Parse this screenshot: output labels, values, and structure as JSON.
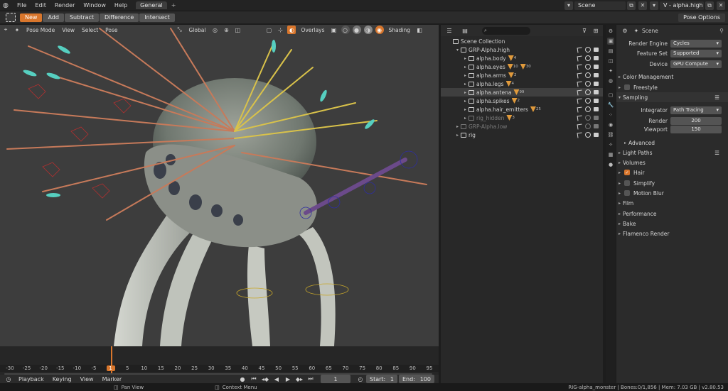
{
  "topbar": {
    "menus": [
      "File",
      "Edit",
      "Render",
      "Window",
      "Help"
    ],
    "workspace_tab": "General",
    "add_tab": "+",
    "scene_name": "Scene",
    "view_layer": "V - alpha.high"
  },
  "toolbar": {
    "modes": [
      "New",
      "Add",
      "Subtract",
      "Difference",
      "Intersect"
    ],
    "active_mode": "New",
    "pose_options": "Pose Options"
  },
  "viewport_header": {
    "mode": "Pose Mode",
    "menus": [
      "View",
      "Select",
      "Pose"
    ],
    "orientation": "Global",
    "overlays": "Overlays",
    "shading": "Shading"
  },
  "timeline": {
    "ticks": [
      "-30",
      "-25",
      "-20",
      "-15",
      "-10",
      "-5",
      "1",
      "5",
      "10",
      "15",
      "20",
      "25",
      "30",
      "35",
      "40",
      "45",
      "50",
      "55",
      "60",
      "65",
      "70",
      "75",
      "80",
      "85",
      "90",
      "95"
    ],
    "current_frame": "1",
    "start_label": "Start:",
    "start": "1",
    "end_label": "End:",
    "end": "100",
    "footer_menus": [
      "Playback",
      "Keying",
      "View",
      "Marker"
    ]
  },
  "statusbar": {
    "pan_view": "Pan View",
    "context_menu": "Context Menu",
    "info": "RIG-alpha_monster | Bones:0/1,856 | Mem: 7.03 GB | v2.80.53"
  },
  "outliner": {
    "search_placeholder": "",
    "rows": [
      {
        "label": "Scene Collection",
        "depth": 0,
        "dim": false,
        "tags": []
      },
      {
        "label": "GRP-Alpha.high",
        "depth": 1,
        "dim": false,
        "tags": []
      },
      {
        "label": "alpha.body",
        "depth": 2,
        "dim": false,
        "tags": [
          "4"
        ]
      },
      {
        "label": "alpha.eyes",
        "depth": 2,
        "dim": false,
        "tags": [
          "10",
          "30"
        ]
      },
      {
        "label": "alpha.arms",
        "depth": 2,
        "dim": false,
        "tags": [
          "2"
        ]
      },
      {
        "label": "alpha.legs",
        "depth": 2,
        "dim": false,
        "tags": [
          "4"
        ]
      },
      {
        "label": "alpha.antena",
        "depth": 2,
        "dim": false,
        "tags": [
          "99"
        ]
      },
      {
        "label": "alpha.spikes",
        "depth": 2,
        "dim": false,
        "tags": [
          "2"
        ]
      },
      {
        "label": "alpha.hair_emitters",
        "depth": 2,
        "dim": false,
        "tags": [
          "25"
        ]
      },
      {
        "label": "rig_hidden",
        "depth": 2,
        "dim": true,
        "tags": [
          "3"
        ]
      },
      {
        "label": "GRP-Alpha.low",
        "depth": 1,
        "dim": true,
        "tags": []
      },
      {
        "label": "rig",
        "depth": 1,
        "dim": false,
        "tags": []
      }
    ],
    "selected_index": 6
  },
  "properties": {
    "header": "Scene",
    "render_engine_label": "Render Engine",
    "render_engine": "Cycles",
    "feature_set_label": "Feature Set",
    "feature_set": "Supported",
    "device_label": "Device",
    "device": "GPU Compute",
    "panels": {
      "color_management": "Color Management",
      "freestyle": "Freestyle",
      "sampling": "Sampling",
      "integrator_label": "Integrator",
      "integrator": "Path Tracing",
      "render_label": "Render",
      "render_samples": "200",
      "viewport_label": "Viewport",
      "viewport_samples": "150",
      "advanced": "Advanced",
      "light_paths": "Light Paths",
      "volumes": "Volumes",
      "hair": "Hair",
      "simplify": "Simplify",
      "motion_blur": "Motion Blur",
      "film": "Film",
      "performance": "Performance",
      "bake": "Bake",
      "flamenco": "Flamenco Render"
    }
  },
  "colors": {
    "accent": "#d9762c",
    "panel_bg": "#2b2b2b",
    "viewport_bg": "#3d3d3d",
    "selected_row": "#3f3f3f"
  }
}
